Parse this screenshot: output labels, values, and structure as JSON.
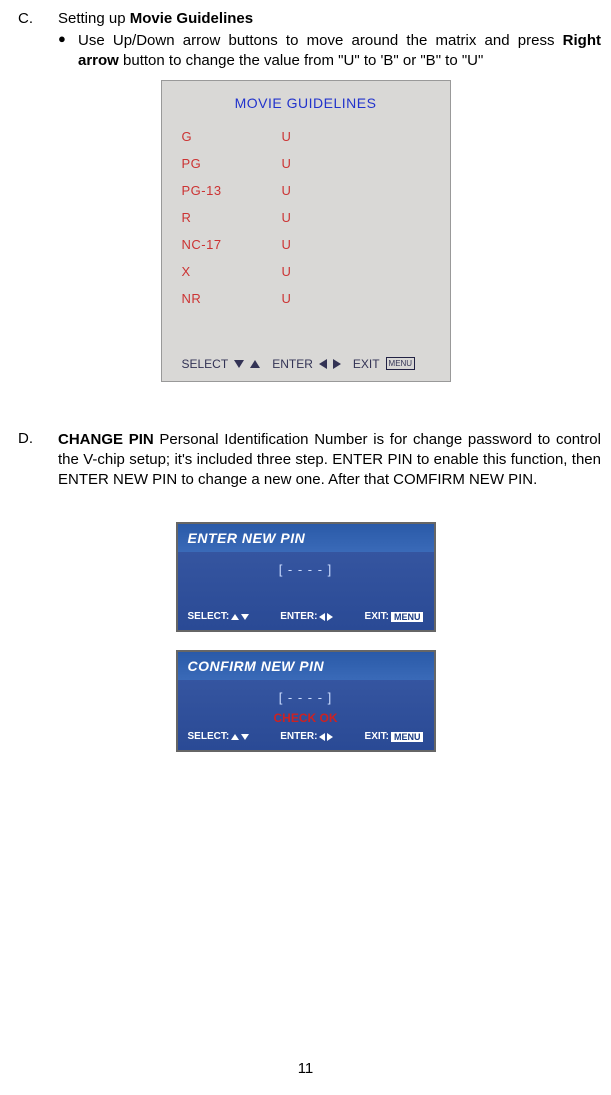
{
  "sectionC": {
    "label": "C.",
    "lead": "Setting up ",
    "title": "Movie Guidelines",
    "bullet": "Use Up/Down arrow buttons to move around the matrix and press ",
    "bullet_bold": "Right arrow",
    "bullet_tail": " button to change the value from \"U\" to 'B\" or \"B\" to \"U\""
  },
  "moviePanel": {
    "title": "MOVIE GUIDELINES",
    "rows": [
      {
        "label": "G",
        "value": "U"
      },
      {
        "label": "PG",
        "value": "U"
      },
      {
        "label": "PG-13",
        "value": "U"
      },
      {
        "label": "R",
        "value": "U"
      },
      {
        "label": "NC-17",
        "value": "U"
      },
      {
        "label": "X",
        "value": "U"
      },
      {
        "label": "NR",
        "value": "U"
      }
    ],
    "footer": {
      "select": "SELECT",
      "enter": "ENTER",
      "exit": "EXIT",
      "menu": "MENU"
    }
  },
  "sectionD": {
    "label": "D.",
    "bold": "CHANGE PIN",
    "text": " Personal Identification Number is for change password to control the V-chip setup; it's included three step. ENTER PIN to enable this function, then ENTER NEW PIN to change a new one. After that COMFIRM NEW PIN."
  },
  "pin1": {
    "header": "ENTER NEW PIN",
    "value": "[ - - - - ]",
    "footer": {
      "select": "SELECT:",
      "enter": "ENTER:",
      "exit": "EXIT:",
      "menu": "MENU"
    }
  },
  "pin2": {
    "header": "CONFIRM NEW PIN",
    "value": "[ - - - - ]",
    "check": "CHECK OK",
    "footer": {
      "select": "SELECT:",
      "enter": "ENTER:",
      "exit": "EXIT:",
      "menu": "MENU"
    }
  },
  "pageNumber": "11"
}
